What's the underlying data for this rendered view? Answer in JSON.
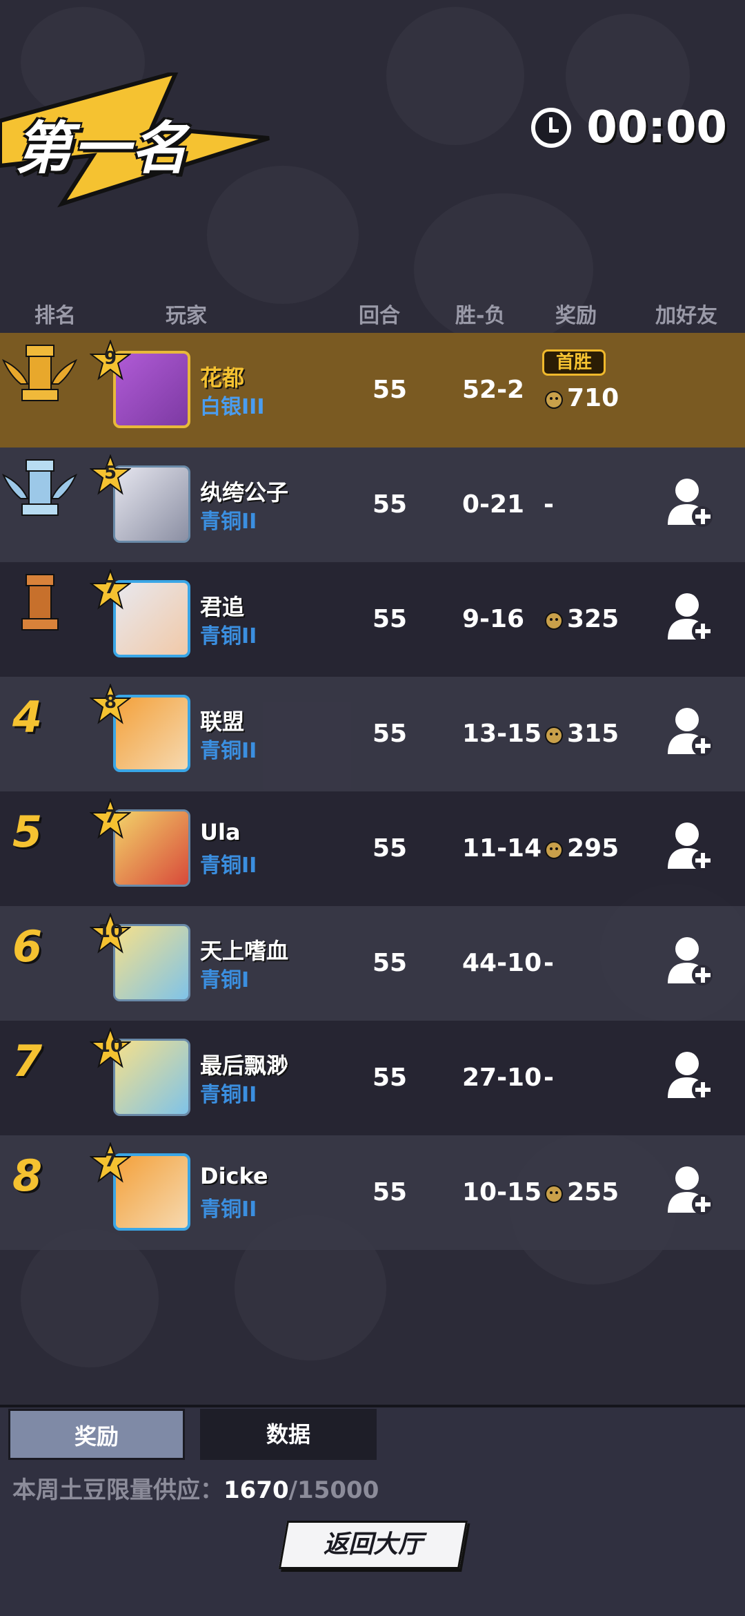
{
  "header": {
    "rank_title": "第一名",
    "timer": "00:00"
  },
  "columns": {
    "rank": "排名",
    "player": "玩家",
    "rounds": "回合",
    "win_loss": "胜-负",
    "reward": "奖励",
    "add_friend": "加好友"
  },
  "players": [
    {
      "rank": "1",
      "level": "9",
      "name": "花都",
      "tier": "白银III",
      "rounds": "55",
      "win_loss": "52-2",
      "reward": "710",
      "badge": "首胜"
    },
    {
      "rank": "2",
      "level": "5",
      "name": "纨绔公子",
      "tier": "青铜II",
      "rounds": "55",
      "win_loss": "0-21",
      "reward": "-"
    },
    {
      "rank": "3",
      "level": "7",
      "name": "君追",
      "tier": "青铜II",
      "rounds": "55",
      "win_loss": "9-16",
      "reward": "325"
    },
    {
      "rank": "4",
      "level": "8",
      "name": "联盟",
      "tier": "青铜II",
      "rounds": "55",
      "win_loss": "13-15",
      "reward": "315"
    },
    {
      "rank": "5",
      "level": "7",
      "name": "Ula",
      "tier": "青铜II",
      "rounds": "55",
      "win_loss": "11-14",
      "reward": "295"
    },
    {
      "rank": "6",
      "level": "10",
      "name": "天上嗜血",
      "tier": "青铜I",
      "rounds": "55",
      "win_loss": "44-10",
      "reward": "-"
    },
    {
      "rank": "7",
      "level": "10",
      "name": "最后飘渺",
      "tier": "青铜II",
      "rounds": "55",
      "win_loss": "27-10",
      "reward": "-"
    },
    {
      "rank": "8",
      "level": "7",
      "name": "Dicke",
      "tier": "青铜II",
      "rounds": "55",
      "win_loss": "10-15",
      "reward": "255"
    }
  ],
  "tabs": {
    "reward": "奖励",
    "data": "数据"
  },
  "supply": {
    "label": "本周土豆限量供应：",
    "current": "1670",
    "total": "/15000"
  },
  "return_button": "返回大厅",
  "colors": {
    "background": "#2c2b38",
    "first_row": "#7a5a22",
    "rank_gold": "#f5c231",
    "tier_blue": "#3b8fe0"
  }
}
